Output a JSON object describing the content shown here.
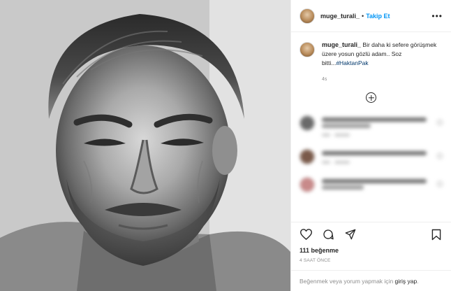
{
  "header": {
    "username": "muge_turali_",
    "separator": "•",
    "follow_label": "Takip Et",
    "more_label": "•••"
  },
  "caption": {
    "username": "muge_turali_",
    "text": "Bir daha ki sefere görüşmek üzere yosun gözlü adam.. Soz bitti...",
    "hashtag": "#HaktanPak",
    "time": "4s"
  },
  "hidden_comments": [
    {
      "icon": "blurred-avatar"
    },
    {
      "icon": "blurred-avatar"
    },
    {
      "icon": "blurred-avatar"
    }
  ],
  "actions": {
    "like_icon": "heart-icon",
    "comment_icon": "comment-icon",
    "share_icon": "share-icon",
    "save_icon": "bookmark-icon"
  },
  "likes": "111 beğenme",
  "timestamp": "4 SAAT ÖNCE",
  "login_prompt": {
    "before": "Beğenmek veya yorum yapmak için ",
    "link": "giriş yap",
    "after": "."
  },
  "colors": {
    "follow_blue": "#0095f6",
    "hashtag_blue": "#00376b",
    "muted_gray": "#8e8e8e",
    "border": "#efefef"
  }
}
